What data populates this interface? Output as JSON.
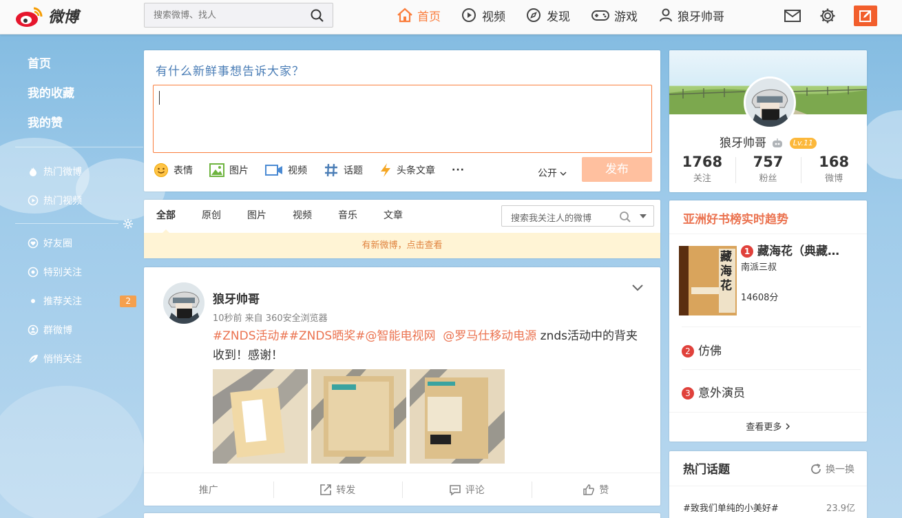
{
  "topbar": {
    "logo_text": "微博",
    "search_placeholder": "搜索微博、找人",
    "nav": [
      {
        "label": "首页",
        "icon": "home-icon",
        "active": true
      },
      {
        "label": "视频",
        "icon": "video-play-icon",
        "active": false
      },
      {
        "label": "发现",
        "icon": "compass-icon",
        "active": false
      },
      {
        "label": "游戏",
        "icon": "gamepad-icon",
        "active": false
      },
      {
        "label": "狼牙帅哥",
        "icon": "user-icon",
        "active": false
      }
    ]
  },
  "leftnav": {
    "main": [
      "首页",
      "我的收藏",
      "我的赞"
    ],
    "items": [
      {
        "label": "热门微博",
        "icon": "fire-icon"
      },
      {
        "label": "热门视频",
        "icon": "video-icon"
      }
    ],
    "groups": [
      {
        "label": "好友圈",
        "icon": "heart-icon"
      },
      {
        "label": "特别关注",
        "icon": "eye-icon"
      },
      {
        "label": "推荐关注",
        "icon": "dot-icon",
        "badge": "2"
      },
      {
        "label": "群微博",
        "icon": "group-icon"
      },
      {
        "label": "悄悄关注",
        "icon": "leaf-icon"
      }
    ]
  },
  "publish": {
    "prompt": "有什么新鲜事想告诉大家？",
    "tools": [
      "表情",
      "图片",
      "视频",
      "话题",
      "头条文章"
    ],
    "more": "···",
    "visibility": "公开",
    "submit": "发布"
  },
  "feed": {
    "tabs": [
      "全部",
      "原创",
      "图片",
      "视频",
      "音乐",
      "文章"
    ],
    "search_placeholder": "搜索我关注人的微博",
    "new_notice": "有新微博，点击查看"
  },
  "post": {
    "author": "狼牙帅哥",
    "meta": "10秒前 来自 360安全浏览器",
    "tags": [
      "#ZNDS活动#",
      "#ZNDS晒奖#",
      "@智能电视网",
      "@罗马仕移动电源"
    ],
    "text_tail": " znds活动中的背夹收到！感谢！",
    "actions": [
      "推广",
      "转发",
      "评论",
      "赞"
    ]
  },
  "profile": {
    "name": "狼牙帅哥",
    "level": "Lv.11",
    "stats": [
      {
        "num": "1768",
        "label": "关注"
      },
      {
        "num": "757",
        "label": "粉丝"
      },
      {
        "num": "168",
        "label": "微博"
      }
    ]
  },
  "books": {
    "title": "亚洲好书榜实时趋势",
    "first": {
      "rank": "1",
      "title": "藏海花（典藏…",
      "author": "南派三叔",
      "score": "14608分",
      "cover_text": "藏海花"
    },
    "rows": [
      {
        "rank": "2",
        "title": "仿佛"
      },
      {
        "rank": "3",
        "title": "意外演员"
      }
    ],
    "more": "查看更多"
  },
  "topics": {
    "title": "热门话题",
    "refresh": "换一换",
    "rows": [
      {
        "name": "#致我们单纯的小美好#",
        "count": "23.9亿"
      }
    ]
  },
  "colors": {
    "accent": "#fa7d3c",
    "link": "#eb7350",
    "prompt": "#4a7db6",
    "badge": "#f5a04e"
  }
}
